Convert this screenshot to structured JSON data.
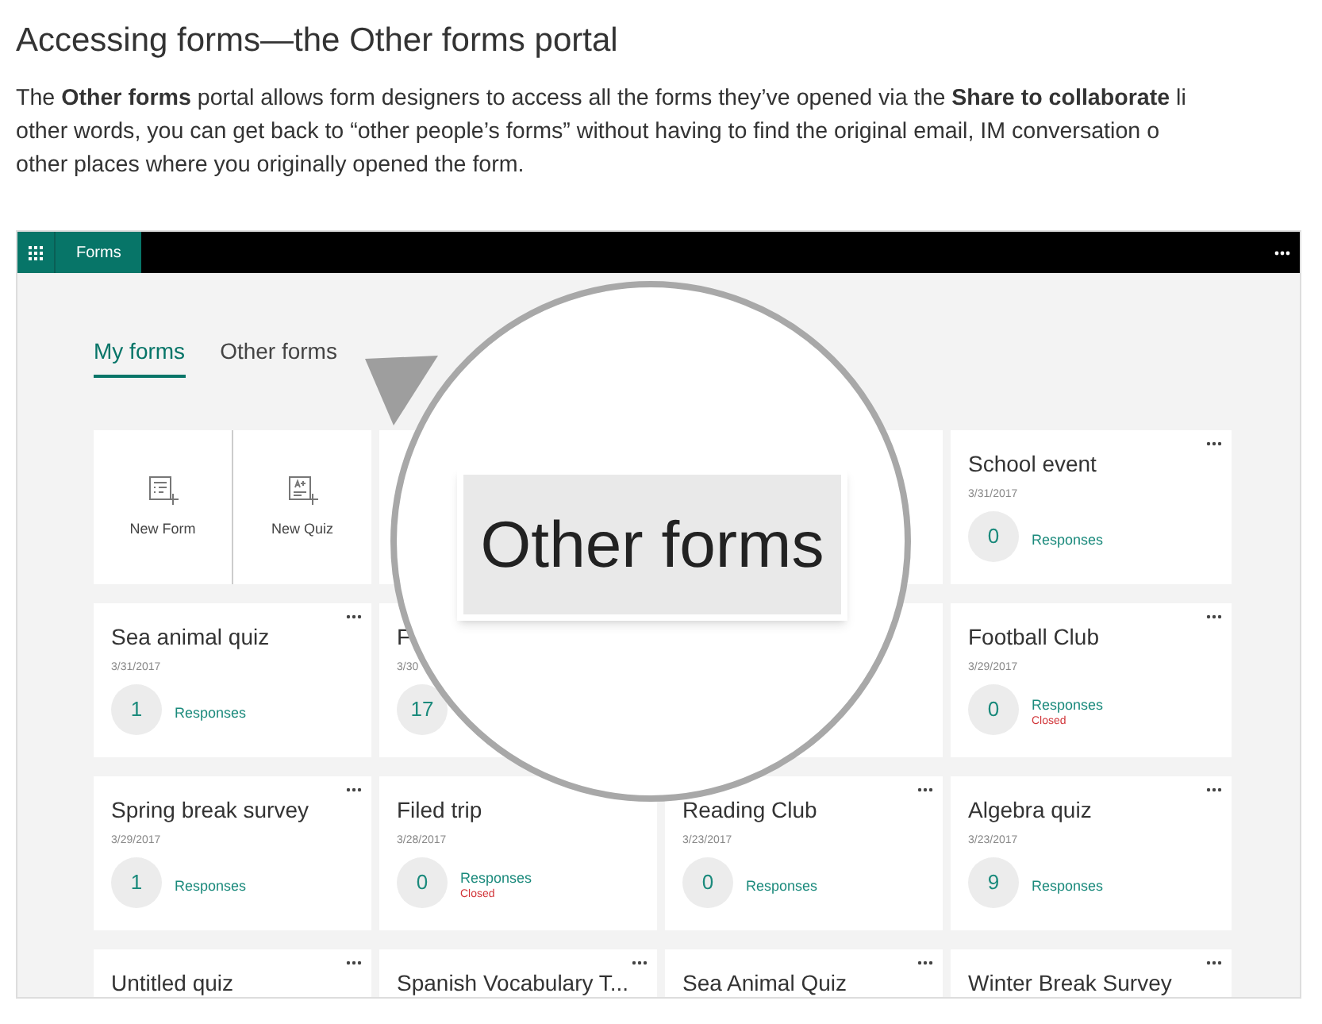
{
  "article": {
    "title": "Accessing forms—the Other forms portal",
    "paragraph_lines": [
      "The **Other forms** portal allows form designers to access all the forms they’ve opened via the **Share to collaborate** li",
      "other words, you can get back to “other people’s forms” without having to find the original email, IM conversation o",
      "other places where you originally opened the form."
    ]
  },
  "app": {
    "app_name": "Forms",
    "tabs": [
      {
        "label": "My forms",
        "selected": true
      },
      {
        "label": "Other forms",
        "selected": false
      }
    ],
    "create_tiles": [
      {
        "label": "New Form",
        "kind": "form"
      },
      {
        "label": "New Quiz",
        "kind": "quiz"
      }
    ],
    "cards": [
      {
        "kind": "covered"
      },
      {
        "kind": "covered"
      },
      {
        "kind": "form",
        "title": "School event",
        "date": "3/31/2017",
        "count": "0",
        "label": "Responses"
      },
      {
        "kind": "form",
        "title": "Sea animal quiz",
        "date": "3/31/2017",
        "count": "1",
        "label": "Responses"
      },
      {
        "kind": "partial",
        "title": "F",
        "date": "3/30",
        "count": "17"
      },
      {
        "kind": "covered"
      },
      {
        "kind": "form",
        "title": "Football Club",
        "date": "3/29/2017",
        "count": "0",
        "label": "Responses",
        "status": "Closed"
      },
      {
        "kind": "form",
        "title": "Spring break survey",
        "date": "3/29/2017",
        "count": "1",
        "label": "Responses"
      },
      {
        "kind": "form",
        "title": "Filed trip",
        "date": "3/28/2017",
        "count": "0",
        "label": "Responses",
        "status": "Closed"
      },
      {
        "kind": "form",
        "title": "Reading Club",
        "date": "3/23/2017",
        "count": "0",
        "label": "Responses"
      },
      {
        "kind": "form",
        "title": "Algebra quiz",
        "date": "3/23/2017",
        "count": "9",
        "label": "Responses"
      },
      {
        "kind": "form",
        "title": "Untitled quiz"
      },
      {
        "kind": "form",
        "title": "Spanish Vocabulary T..."
      },
      {
        "kind": "form",
        "title": "Sea Animal Quiz"
      },
      {
        "kind": "form",
        "title": "Winter Break Survey"
      }
    ],
    "magnifier": {
      "text": "Other forms"
    }
  }
}
